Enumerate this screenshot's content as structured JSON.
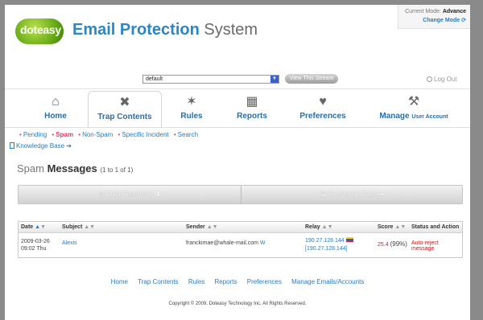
{
  "header": {
    "logo_text": "doteasy",
    "title_main": "Email Protection",
    "title_light": "System",
    "mode_label": "Current Mode:",
    "mode_value": "Advance",
    "change_mode": "Change Mode"
  },
  "stream": {
    "selected": "default",
    "view_button": "View This Stream",
    "logout": "Log Out"
  },
  "nav": {
    "items": [
      {
        "label": "Home",
        "icon": "home-icon"
      },
      {
        "label": "Trap Contents",
        "icon": "trap-icon"
      },
      {
        "label": "Rules",
        "icon": "rules-icon"
      },
      {
        "label": "Reports",
        "icon": "reports-icon"
      },
      {
        "label": "Preferences",
        "icon": "heart-icon"
      },
      {
        "label": "Manage",
        "sub": "User Account",
        "icon": "tools-icon"
      }
    ]
  },
  "subnav": {
    "links": [
      "Pending",
      "Spam",
      "Non-Spam",
      "Specific Incident",
      "Search"
    ],
    "knowledge_base": "Knowledge Base"
  },
  "main": {
    "title_first": "Spam",
    "title_rest": "Messages",
    "count": "(1 to 1 of 1)",
    "quick_reference": "Quick Reference",
    "knowledge_base": "Knowledge Base"
  },
  "table": {
    "headers": [
      "Date",
      "Subject",
      "Sender",
      "Relay",
      "Score",
      "Status and Action"
    ],
    "rows": [
      {
        "date": "2009-03-26",
        "time": "09:02 Thu",
        "subject": "Alexis",
        "sender": "franckimae@whale-mail.com",
        "sender_link": "W",
        "relay_1": "190.27.128.144",
        "relay_2": "[190.27.128.144]",
        "score": "25.4",
        "score_pct": "(99%)",
        "status": "Auto-reject message"
      }
    ]
  },
  "footer": {
    "links": [
      "Home",
      "Trap Contents",
      "Rules",
      "Reports",
      "Preferences",
      "Manage Emails/Accounts"
    ],
    "copyright": "Copyright © 2009. Doteasy Technology Inc. All Rights Reserved."
  },
  "colors": {
    "brand_blue": "#2a86c4",
    "link_blue": "#2a7bc0",
    "accent_red": "#c02020",
    "logo_green": "#5fa312"
  }
}
